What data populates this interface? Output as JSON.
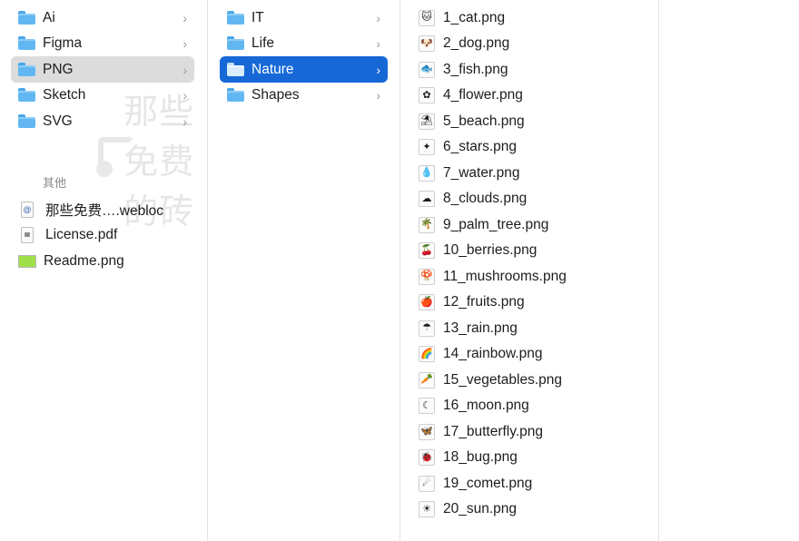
{
  "sidebar_folders": [
    {
      "label": "Ai"
    },
    {
      "label": "Figma"
    },
    {
      "label": "PNG",
      "selected": true
    },
    {
      "label": "Sketch"
    },
    {
      "label": "SVG"
    }
  ],
  "other_section": {
    "title": "其他",
    "items": [
      {
        "label": "那些免费….webloc",
        "icon": "weblink-doc-icon",
        "glyph": "@"
      },
      {
        "label": "License.pdf",
        "icon": "pdf-doc-icon"
      },
      {
        "label": "Readme.png",
        "icon": "image-thumbnail-icon"
      }
    ]
  },
  "png_folders": [
    {
      "label": "IT"
    },
    {
      "label": "Life"
    },
    {
      "label": "Nature",
      "selected": true
    },
    {
      "label": "Shapes"
    }
  ],
  "nature_files": [
    {
      "label": "1_cat.png",
      "glyph": "🐱"
    },
    {
      "label": "2_dog.png",
      "glyph": "🐶"
    },
    {
      "label": "3_fish.png",
      "glyph": "🐟"
    },
    {
      "label": "4_flower.png",
      "glyph": "✿"
    },
    {
      "label": "5_beach.png",
      "glyph": "⛱"
    },
    {
      "label": "6_stars.png",
      "glyph": "✦"
    },
    {
      "label": "7_water.png",
      "glyph": "💧"
    },
    {
      "label": "8_clouds.png",
      "glyph": "☁"
    },
    {
      "label": "9_palm_tree.png",
      "glyph": "🌴"
    },
    {
      "label": "10_berries.png",
      "glyph": "🍒"
    },
    {
      "label": "11_mushrooms.png",
      "glyph": "🍄"
    },
    {
      "label": "12_fruits.png",
      "glyph": "🍎"
    },
    {
      "label": "13_rain.png",
      "glyph": "☂"
    },
    {
      "label": "14_rainbow.png",
      "glyph": "🌈"
    },
    {
      "label": "15_vegetables.png",
      "glyph": "🥕"
    },
    {
      "label": "16_moon.png",
      "glyph": "☾"
    },
    {
      "label": "17_butterfly.png",
      "glyph": "🦋"
    },
    {
      "label": "18_bug.png",
      "glyph": "🐞"
    },
    {
      "label": "19_comet.png",
      "glyph": "☄"
    },
    {
      "label": "20_sun.png",
      "glyph": "☀"
    }
  ],
  "watermark": {
    "text": "那些免费的砖"
  },
  "colors": {
    "selection_blue": "#1568d6",
    "selection_grey": "#dcdcdc",
    "folder_blue": "#62b7f2"
  }
}
